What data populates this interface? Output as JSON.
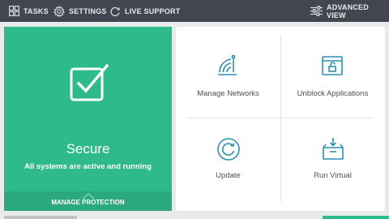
{
  "topbar": {
    "tasks_label": "TASKS",
    "settings_label": "SETTINGS",
    "live_support_label": "LIVE SUPPORT",
    "advanced_view_label": "ADVANCED VIEW"
  },
  "status": {
    "title": "Secure",
    "subtitle": "All systems are active and running",
    "manage_label": "MANAGE PROTECTION"
  },
  "tiles": [
    {
      "label": "Manage Networks",
      "icon": "wifi-router-icon"
    },
    {
      "label": "Unblock Applications",
      "icon": "unlock-window-icon"
    },
    {
      "label": "Update",
      "icon": "update-icon"
    },
    {
      "label": "Run Virtual",
      "icon": "sandbox-box-icon"
    }
  ],
  "colors": {
    "topbar": "#42464f",
    "secure_green": "#2fba8a",
    "secure_green_dark": "#29a97c",
    "icon_teal": "#2e8fb0",
    "background": "#e9eaec"
  }
}
